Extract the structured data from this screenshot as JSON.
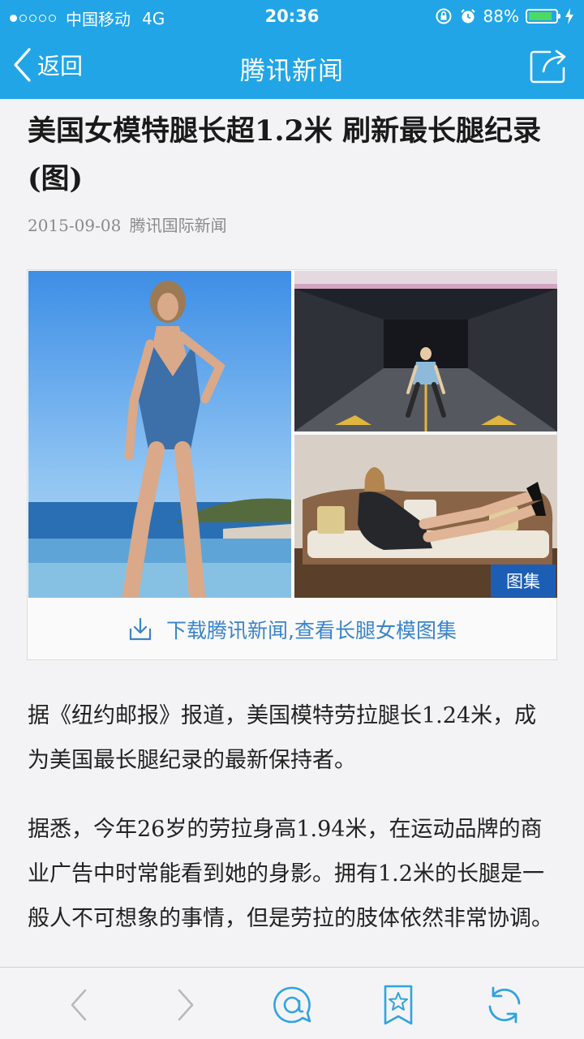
{
  "status_bar": {
    "carrier": "中国移动",
    "network": "4G",
    "time": "20:36",
    "battery": "88%",
    "battery_level": 0.88,
    "signal_bars_filled": 1,
    "icons": [
      "orientation-lock-icon",
      "alarm-icon",
      "battery-icon",
      "charging-bolt-icon"
    ]
  },
  "nav": {
    "back_label": "返回",
    "title": "腾讯新闻",
    "share_icon": "share-icon"
  },
  "article": {
    "title": "美国女模特腿长超1.2米 刷新最长腿纪录(图)",
    "date": "2015-09-08",
    "source": "腾讯国际新闻",
    "gallery": {
      "badge": "图集",
      "download_text": "下载腾讯新闻,查看长腿女模图集",
      "download_icon": "download-icon"
    },
    "paragraphs": [
      "据《纽约邮报》报道，美国模特劳拉腿长1.24米，成为美国最长腿纪录的最新保持者。",
      "据悉，今年26岁的劳拉身高1.94米，在运动品牌的商业广告中时常能看到她的身影。拥有1.2米的长腿是一般人不可想象的事情，但是劳拉的肢体依然非常协调。"
    ]
  },
  "colors": {
    "header": "#21a5e6",
    "accent": "#2fa3e0",
    "link": "#3a84c9",
    "badge": "#1d5eb5"
  },
  "toolbar": {
    "items": [
      "back-icon",
      "forward-icon",
      "comment-icon",
      "favorite-icon",
      "refresh-icon"
    ]
  }
}
